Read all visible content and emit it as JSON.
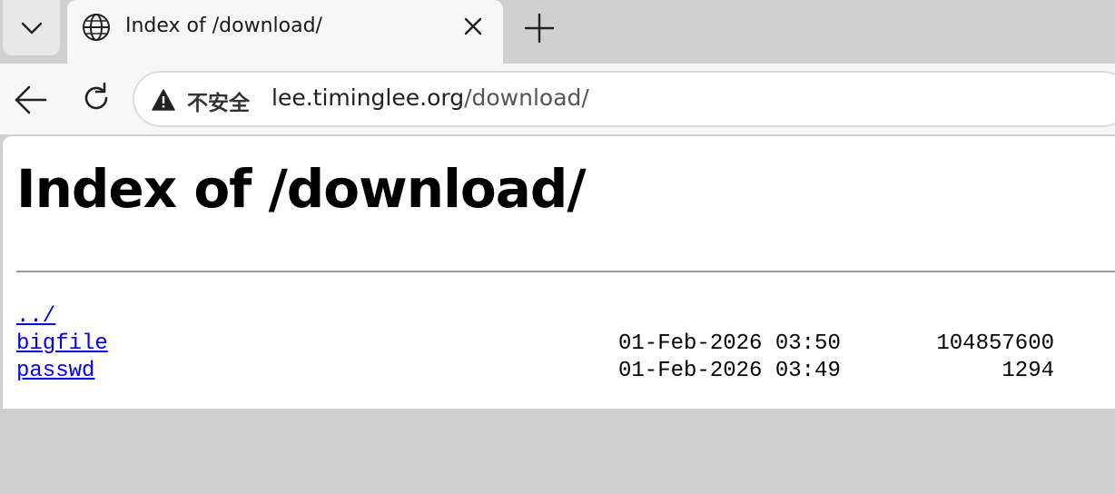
{
  "browser": {
    "tab": {
      "title": "Index of /download/",
      "icon": "globe-icon"
    },
    "address_bar": {
      "security_label": "不安全",
      "url_host": "lee.timinglee.org",
      "url_path": "/download/"
    }
  },
  "page": {
    "heading": "Index of /download/",
    "entries": [
      {
        "name": "../",
        "date": "",
        "size": ""
      },
      {
        "name": "bigfile",
        "date": "01-Feb-2026 03:50",
        "size": "104857600"
      },
      {
        "name": "passwd",
        "date": "01-Feb-2026 03:49",
        "size": "1294"
      }
    ]
  },
  "colors": {
    "link": "#0000ee",
    "tab_bg": "#f7f7f7",
    "strip_bg": "#d0d0d0"
  }
}
